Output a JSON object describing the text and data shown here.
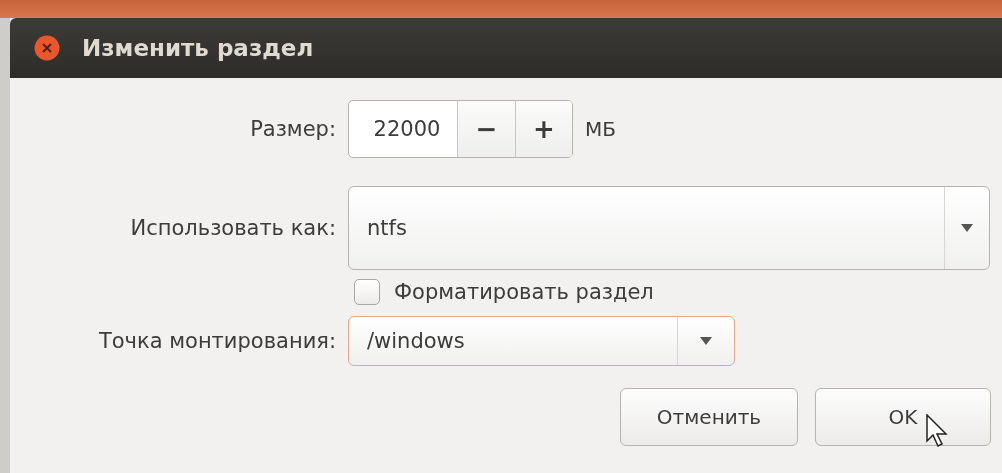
{
  "window": {
    "title": "Изменить раздел"
  },
  "size": {
    "label": "Размер:",
    "value": "22000",
    "decrement": "−",
    "increment": "+",
    "unit": "МБ"
  },
  "use_as": {
    "label": "Использовать как:",
    "value": "ntfs",
    "focused": false
  },
  "format": {
    "label": "Форматировать раздел",
    "checked": false
  },
  "mount_point": {
    "label": "Точка монтирования:",
    "value": "/windows",
    "focused": true
  },
  "buttons": [
    {
      "label": "Отменить"
    },
    {
      "label": "OK"
    }
  ]
}
